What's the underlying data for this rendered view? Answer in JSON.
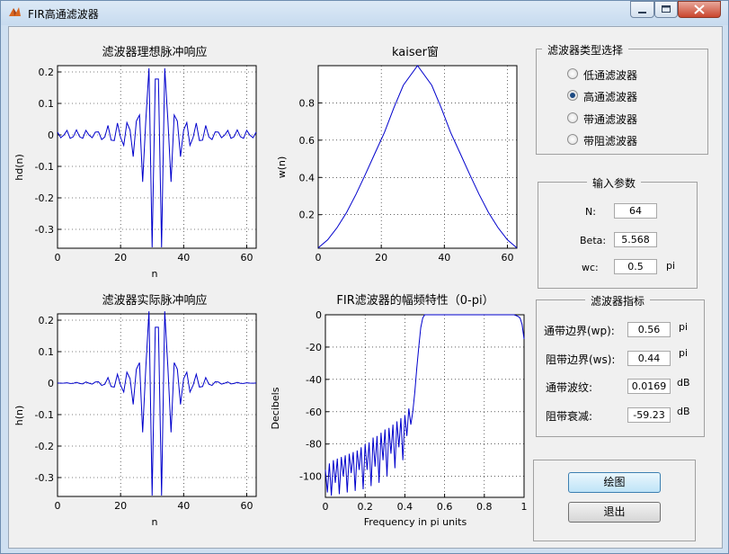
{
  "window": {
    "title": "FIR高通滤波器",
    "buttons": [
      "minimize",
      "maximize",
      "close"
    ]
  },
  "plots": [
    {
      "id": "ideal",
      "title": "滤波器理想脉冲响应",
      "xlabel": "n",
      "ylabel": "hd(n)",
      "xticks": [
        "0",
        "20",
        "40",
        "60"
      ],
      "yticks": [
        "0.2",
        "0.1",
        "0",
        "-0.1",
        "-0.2",
        "-0.3"
      ]
    },
    {
      "id": "window",
      "title": "kaiser窗",
      "xlabel": "",
      "ylabel": "w(n)",
      "xticks": [
        "0",
        "20",
        "40",
        "60"
      ],
      "yticks": [
        "0.8",
        "0.6",
        "0.4",
        "0.2"
      ]
    },
    {
      "id": "actual",
      "title": "滤波器实际脉冲响应",
      "xlabel": "n",
      "ylabel": "h(n)",
      "xticks": [
        "0",
        "20",
        "40",
        "60"
      ],
      "yticks": [
        "0.2",
        "0.1",
        "0",
        "-0.1",
        "-0.2",
        "-0.3"
      ]
    },
    {
      "id": "magnitude",
      "title": "FIR滤波器的幅频特性（0-pi）",
      "xlabel": "Frequency in pi units",
      "ylabel": "Decibels",
      "xticks": [
        "0",
        "0.2",
        "0.4",
        "0.6",
        "0.8",
        "1"
      ],
      "yticks": [
        "0",
        "-20",
        "-40",
        "-60",
        "-80",
        "-100"
      ]
    }
  ],
  "chart_data": [
    {
      "type": "line",
      "title": "滤波器理想脉冲响应",
      "xlabel": "n",
      "ylabel": "hd(n)",
      "xlim": [
        0,
        63
      ],
      "ylim": [
        -0.36,
        0.22
      ],
      "grid": true,
      "series": [
        {
          "color": "#0000cc",
          "x": [
            0,
            1,
            2,
            3,
            4,
            5,
            6,
            7,
            8,
            9,
            10,
            11,
            12,
            13,
            14,
            15,
            16,
            17,
            18,
            19,
            20,
            21,
            22,
            23,
            24,
            25,
            26,
            27,
            28,
            29,
            30,
            31,
            32,
            33,
            34,
            35,
            36,
            37,
            38,
            39,
            40,
            41,
            42,
            43,
            44,
            45,
            46,
            47,
            48,
            49,
            50,
            51,
            52,
            53,
            54,
            55,
            56,
            57,
            58,
            59,
            60,
            61,
            62,
            63
          ],
          "y": [
            0.0091,
            -0.0089,
            -0.0009,
            0.0144,
            -0.0109,
            -0.0058,
            0.0159,
            -0.0058,
            -0.0109,
            0.0144,
            -0.0009,
            -0.0089,
            0.0091,
            0.0096,
            -0.0148,
            -0.0067,
            0.0299,
            -0.0166,
            -0.018,
            0.0377,
            -0.0083,
            -0.0335,
            0.0392,
            0.0152,
            -0.0692,
            0.044,
            0.0633,
            -0.1491,
            0.0466,
            0.2118,
            -0.357,
            0.1776,
            0.1776,
            -0.357,
            0.2118,
            0.0466,
            -0.1491,
            0.0633,
            0.044,
            -0.0692,
            0.0152,
            0.0392,
            -0.0335,
            -0.0083,
            0.0377,
            -0.018,
            -0.0166,
            0.0299,
            -0.0067,
            -0.0148,
            0.0096,
            0.0091,
            -0.0089,
            -0.0009,
            0.0144,
            -0.0109,
            -0.0058,
            0.0159,
            -0.0058,
            -0.0109,
            0.0144,
            -0.0009,
            -0.0089,
            0.0091
          ]
        }
      ]
    },
    {
      "type": "line",
      "title": "kaiser窗",
      "xlabel": "",
      "ylabel": "w(n)",
      "xlim": [
        0,
        63
      ],
      "ylim": [
        0.02,
        1.0
      ],
      "grid": true,
      "series": [
        {
          "color": "#0000cc",
          "x": [
            0,
            3,
            6,
            9,
            12,
            15,
            18,
            21,
            24,
            27,
            31.5,
            36,
            39,
            42,
            45,
            48,
            51,
            54,
            57,
            60,
            63
          ],
          "y": [
            0.022,
            0.065,
            0.131,
            0.212,
            0.31,
            0.418,
            0.53,
            0.641,
            0.774,
            0.895,
            1.0,
            0.895,
            0.774,
            0.641,
            0.53,
            0.418,
            0.31,
            0.212,
            0.131,
            0.065,
            0.022
          ]
        }
      ]
    },
    {
      "type": "line",
      "title": "滤波器实际脉冲响应",
      "xlabel": "n",
      "ylabel": "h(n)",
      "xlim": [
        0,
        63
      ],
      "ylim": [
        -0.36,
        0.22
      ],
      "grid": true,
      "series": [
        {
          "color": "#0000cc",
          "x": [
            0,
            1,
            2,
            3,
            4,
            5,
            6,
            7,
            8,
            9,
            10,
            11,
            12,
            13,
            14,
            15,
            16,
            17,
            18,
            19,
            20,
            21,
            22,
            23,
            24,
            25,
            26,
            27,
            28,
            29,
            30,
            31,
            32,
            33,
            34,
            35,
            36,
            37,
            38,
            39,
            40,
            41,
            42,
            43,
            44,
            45,
            46,
            47,
            48,
            49,
            50,
            51,
            52,
            53,
            54,
            55,
            56,
            57,
            58,
            59,
            60,
            61,
            62,
            63
          ],
          "y": [
            0.0002,
            -0.0003,
            0.0,
            0.001,
            -0.001,
            -0.0007,
            0.0024,
            -0.0011,
            -0.0025,
            0.0038,
            -0.0003,
            -0.0031,
            0.0036,
            0.0042,
            -0.0073,
            -0.0036,
            0.0177,
            -0.0107,
            -0.0126,
            0.0283,
            -0.0066,
            -0.0283,
            0.0349,
            0.0143,
            -0.0676,
            0.0443,
            0.0651,
            -0.1565,
            0.0496,
            0.2281,
            -0.357,
            0.1776,
            0.1776,
            -0.357,
            0.2281,
            0.0496,
            -0.1565,
            0.0651,
            0.0443,
            -0.0676,
            0.0143,
            0.0349,
            -0.0283,
            -0.0066,
            0.0283,
            -0.0126,
            -0.0107,
            0.0177,
            -0.0036,
            -0.0073,
            0.0042,
            0.0036,
            -0.0031,
            -0.0003,
            0.0038,
            -0.0025,
            -0.0011,
            0.0024,
            -0.0007,
            -0.001,
            0.001,
            0.0,
            -0.0003,
            0.0002
          ]
        }
      ]
    },
    {
      "type": "line",
      "title": "FIR滤波器的幅频特性（0-pi）",
      "xlabel": "Frequency in pi units",
      "ylabel": "Decibels",
      "xlim": [
        0,
        1
      ],
      "ylim": [
        -113,
        0
      ],
      "grid": true,
      "series": [
        {
          "color": "#0000cc",
          "x": [
            0,
            0.01,
            0.02,
            0.03,
            0.04,
            0.05,
            0.06,
            0.07,
            0.08,
            0.09,
            0.1,
            0.11,
            0.12,
            0.13,
            0.14,
            0.15,
            0.16,
            0.17,
            0.18,
            0.19,
            0.2,
            0.21,
            0.22,
            0.23,
            0.24,
            0.25,
            0.26,
            0.27,
            0.28,
            0.29,
            0.3,
            0.31,
            0.32,
            0.33,
            0.34,
            0.35,
            0.36,
            0.37,
            0.38,
            0.39,
            0.4,
            0.41,
            0.42,
            0.43,
            0.44,
            0.45,
            0.46,
            0.47,
            0.48,
            0.49,
            0.5,
            0.52,
            0.55,
            0.6,
            0.65,
            0.7,
            0.75,
            0.8,
            0.85,
            0.9,
            0.93,
            0.95,
            0.97,
            0.98,
            0.99,
            1.0
          ],
          "y": [
            -96,
            -110,
            -92,
            -112,
            -90,
            -104,
            -89,
            -111,
            -88,
            -100,
            -87,
            -110,
            -86,
            -98,
            -85,
            -109,
            -84,
            -96,
            -82,
            -108,
            -80,
            -96,
            -79,
            -106,
            -76,
            -94,
            -75,
            -104,
            -73,
            -90,
            -71,
            -100,
            -70,
            -86,
            -68,
            -95,
            -66,
            -82,
            -64,
            -90,
            -62,
            -75,
            -58,
            -68,
            -60,
            -48,
            -33,
            -20,
            -8,
            -2,
            0,
            0,
            0,
            0,
            0,
            0,
            0,
            0,
            0,
            0,
            0,
            0,
            -1,
            -2,
            -6,
            -15
          ]
        }
      ]
    }
  ],
  "filter_type": {
    "title": "滤波器类型选择",
    "options": [
      "低通滤波器",
      "高通滤波器",
      "带通滤波器",
      "带阻滤波器"
    ],
    "selected": "高通滤波器"
  },
  "input_params": {
    "title": "输入参数",
    "n_label": "N:",
    "n_value": "64",
    "beta_label": "Beta:",
    "beta_value": "5.568",
    "wc_label": "wc:",
    "wc_value": "0.5",
    "wc_unit": "pi"
  },
  "filter_specs": {
    "title": "滤波器指标",
    "wp_label": "通带边界(wp):",
    "wp_value": "0.56",
    "wp_unit": "pi",
    "ws_label": "阻带边界(ws):",
    "ws_value": "0.44",
    "ws_unit": "pi",
    "ripple_label": "通带波纹:",
    "ripple_value": "0.0169",
    "ripple_unit": "dB",
    "atten_label": "阻带衰减:",
    "atten_value": "-59.23",
    "atten_unit": "dB"
  },
  "actions": {
    "plot_label": "绘图",
    "exit_label": "退出"
  },
  "colors": {
    "plot_line": "#0000cc",
    "window_frame": "#cfe0f1",
    "close_button": "#c9452d"
  }
}
